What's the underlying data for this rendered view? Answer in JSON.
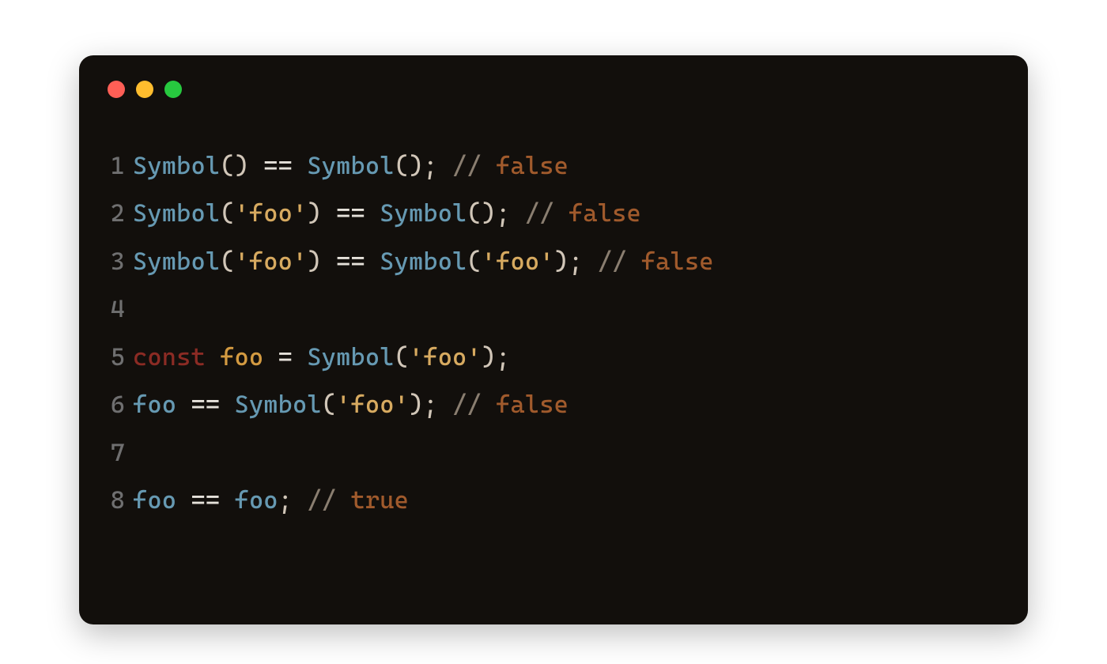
{
  "colors": {
    "red": "#ff5f56",
    "yellow": "#ffbd2e",
    "green": "#27c93f",
    "bg": "#120f0c"
  },
  "code": {
    "lines": [
      {
        "n": "1",
        "tokens": [
          {
            "c": "fn",
            "t": "Symbol"
          },
          {
            "c": "paren",
            "t": "() "
          },
          {
            "c": "op",
            "t": "=="
          },
          {
            "c": "paren",
            "t": " "
          },
          {
            "c": "fn",
            "t": "Symbol"
          },
          {
            "c": "paren",
            "t": "(); "
          },
          {
            "c": "grey",
            "t": "// "
          },
          {
            "c": "orange",
            "t": "false"
          }
        ]
      },
      {
        "n": "2",
        "tokens": [
          {
            "c": "fn",
            "t": "Symbol"
          },
          {
            "c": "paren",
            "t": "("
          },
          {
            "c": "str",
            "t": "'foo'"
          },
          {
            "c": "paren",
            "t": ") "
          },
          {
            "c": "op",
            "t": "=="
          },
          {
            "c": "paren",
            "t": " "
          },
          {
            "c": "fn",
            "t": "Symbol"
          },
          {
            "c": "paren",
            "t": "(); "
          },
          {
            "c": "grey",
            "t": "// "
          },
          {
            "c": "orange",
            "t": "false"
          }
        ]
      },
      {
        "n": "3",
        "tokens": [
          {
            "c": "fn",
            "t": "Symbol"
          },
          {
            "c": "paren",
            "t": "("
          },
          {
            "c": "str",
            "t": "'foo'"
          },
          {
            "c": "paren",
            "t": ") "
          },
          {
            "c": "op",
            "t": "=="
          },
          {
            "c": "paren",
            "t": " "
          },
          {
            "c": "fn",
            "t": "Symbol"
          },
          {
            "c": "paren",
            "t": "("
          },
          {
            "c": "str",
            "t": "'foo'"
          },
          {
            "c": "paren",
            "t": "); "
          },
          {
            "c": "grey",
            "t": "// "
          },
          {
            "c": "orange",
            "t": "false"
          }
        ]
      },
      {
        "n": "4",
        "tokens": [
          {
            "c": "paren",
            "t": ""
          }
        ]
      },
      {
        "n": "5",
        "tokens": [
          {
            "c": "kw",
            "t": "const "
          },
          {
            "c": "var",
            "t": "foo"
          },
          {
            "c": "paren",
            "t": " "
          },
          {
            "c": "op",
            "t": "="
          },
          {
            "c": "paren",
            "t": " "
          },
          {
            "c": "fn",
            "t": "Symbol"
          },
          {
            "c": "paren",
            "t": "("
          },
          {
            "c": "str",
            "t": "'foo'"
          },
          {
            "c": "paren",
            "t": ");"
          }
        ]
      },
      {
        "n": "6",
        "tokens": [
          {
            "c": "fn",
            "t": "foo"
          },
          {
            "c": "paren",
            "t": " "
          },
          {
            "c": "op",
            "t": "=="
          },
          {
            "c": "paren",
            "t": " "
          },
          {
            "c": "fn",
            "t": "Symbol"
          },
          {
            "c": "paren",
            "t": "("
          },
          {
            "c": "str",
            "t": "'foo'"
          },
          {
            "c": "paren",
            "t": "); "
          },
          {
            "c": "grey",
            "t": "// "
          },
          {
            "c": "orange",
            "t": "false"
          }
        ]
      },
      {
        "n": "7",
        "tokens": [
          {
            "c": "paren",
            "t": ""
          }
        ]
      },
      {
        "n": "8",
        "tokens": [
          {
            "c": "fn",
            "t": "foo"
          },
          {
            "c": "paren",
            "t": " "
          },
          {
            "c": "op",
            "t": "=="
          },
          {
            "c": "paren",
            "t": " "
          },
          {
            "c": "fn",
            "t": "foo"
          },
          {
            "c": "paren",
            "t": "; "
          },
          {
            "c": "grey",
            "t": "// "
          },
          {
            "c": "orange",
            "t": "true"
          }
        ]
      }
    ]
  }
}
